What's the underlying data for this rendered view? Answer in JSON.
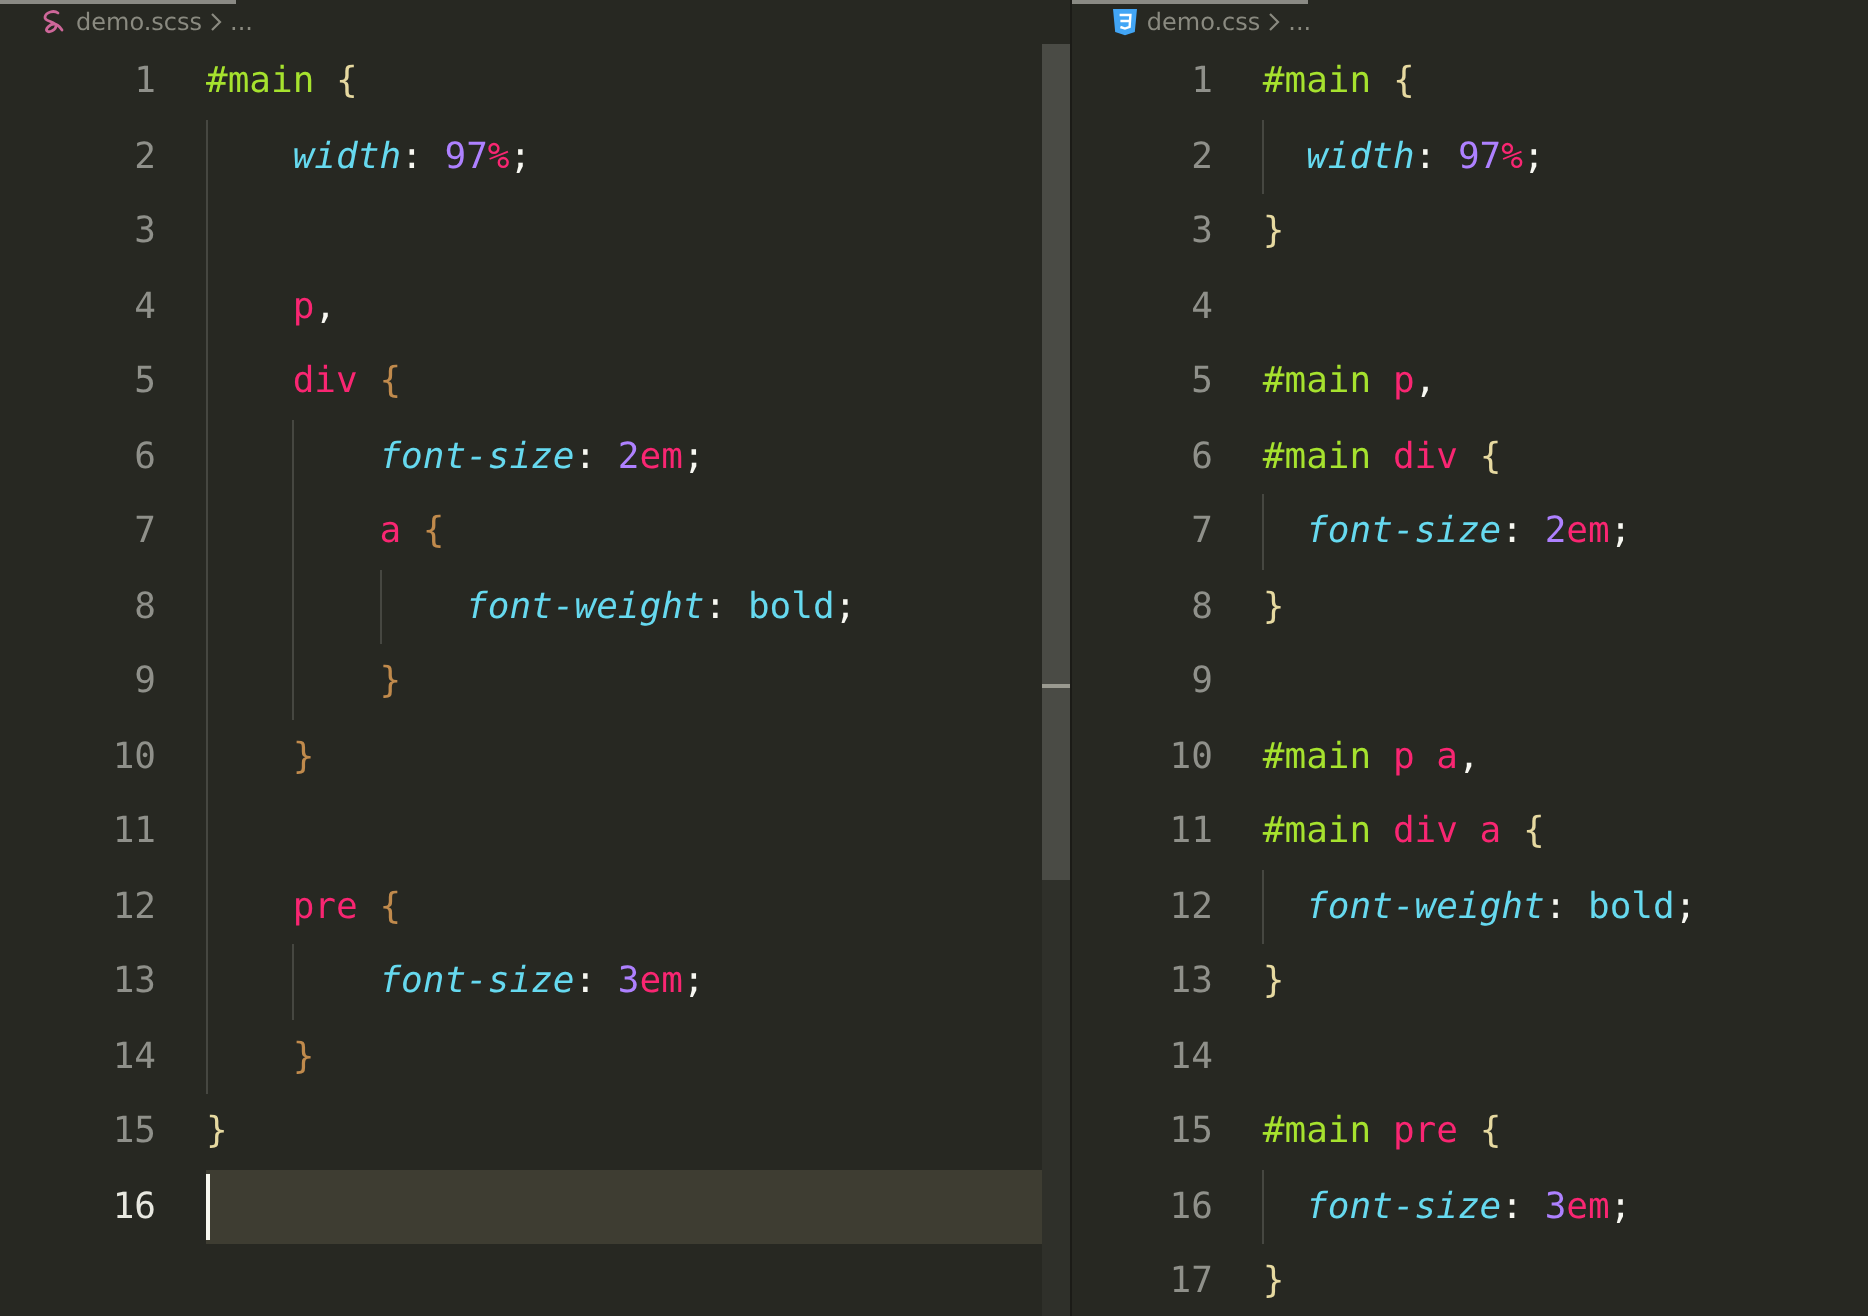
{
  "editors": [
    {
      "file_name": "demo.scss",
      "kind": "scss",
      "breadcrumb_tail": "...",
      "lines": [
        {
          "number": "1",
          "current": false,
          "tokens": [
            {
              "kind": "sel",
              "text": "#main "
            },
            {
              "kind": "brace1",
              "text": "{"
            }
          ]
        },
        {
          "number": "2",
          "current": false,
          "tokens": [
            {
              "kind": "prop",
              "text": "    width"
            },
            {
              "kind": "punct",
              "text": ": "
            },
            {
              "kind": "num",
              "text": "97"
            },
            {
              "kind": "unit",
              "text": "%"
            },
            {
              "kind": "punct",
              "text": ";"
            }
          ]
        },
        {
          "number": "3",
          "current": false
        },
        {
          "number": "4",
          "current": false,
          "tokens": [
            {
              "kind": "tag",
              "text": "    p"
            },
            {
              "kind": "punct",
              "text": ","
            }
          ]
        },
        {
          "number": "5",
          "current": false,
          "tokens": [
            {
              "kind": "tag",
              "text": "    div "
            },
            {
              "kind": "brace2",
              "text": "{"
            }
          ]
        },
        {
          "number": "6",
          "current": false,
          "tokens": [
            {
              "kind": "prop",
              "text": "        font-size"
            },
            {
              "kind": "punct",
              "text": ": "
            },
            {
              "kind": "num",
              "text": "2"
            },
            {
              "kind": "unit",
              "text": "em"
            },
            {
              "kind": "punct",
              "text": ";"
            }
          ]
        },
        {
          "number": "7",
          "current": false,
          "tokens": [
            {
              "kind": "tag",
              "text": "        a "
            },
            {
              "kind": "brace2",
              "text": "{"
            }
          ]
        },
        {
          "number": "8",
          "current": false,
          "tokens": [
            {
              "kind": "prop",
              "text": "            font-weight"
            },
            {
              "kind": "punct",
              "text": ": "
            },
            {
              "kind": "val",
              "text": "bold"
            },
            {
              "kind": "punct",
              "text": ";"
            }
          ]
        },
        {
          "number": "9",
          "current": false,
          "tokens": [
            {
              "kind": "brace2",
              "text": "        }"
            }
          ]
        },
        {
          "number": "10",
          "current": false,
          "tokens": [
            {
              "kind": "brace2",
              "text": "    }"
            }
          ]
        },
        {
          "number": "11",
          "current": false
        },
        {
          "number": "12",
          "current": false,
          "tokens": [
            {
              "kind": "tag",
              "text": "    pre "
            },
            {
              "kind": "brace2",
              "text": "{"
            }
          ]
        },
        {
          "number": "13",
          "current": false,
          "tokens": [
            {
              "kind": "prop",
              "text": "        font-size"
            },
            {
              "kind": "punct",
              "text": ": "
            },
            {
              "kind": "num",
              "text": "3"
            },
            {
              "kind": "unit",
              "text": "em"
            },
            {
              "kind": "punct",
              "text": ";"
            }
          ]
        },
        {
          "number": "14",
          "current": false,
          "tokens": [
            {
              "kind": "brace2",
              "text": "    }"
            }
          ]
        },
        {
          "number": "15",
          "current": false,
          "tokens": [
            {
              "kind": "brace1",
              "text": "}"
            }
          ]
        },
        {
          "number": "16",
          "current": true
        }
      ]
    },
    {
      "file_name": "demo.css",
      "kind": "css",
      "breadcrumb_tail": "...",
      "lines": [
        {
          "number": "1",
          "current": false,
          "tokens": [
            {
              "kind": "sel",
              "text": "#main "
            },
            {
              "kind": "brace1",
              "text": "{"
            }
          ]
        },
        {
          "number": "2",
          "current": false,
          "tokens": [
            {
              "kind": "prop",
              "text": "  width"
            },
            {
              "kind": "punct",
              "text": ": "
            },
            {
              "kind": "num",
              "text": "97"
            },
            {
              "kind": "unit",
              "text": "%"
            },
            {
              "kind": "punct",
              "text": ";"
            }
          ]
        },
        {
          "number": "3",
          "current": false,
          "tokens": [
            {
              "kind": "brace1",
              "text": "}"
            }
          ]
        },
        {
          "number": "4",
          "current": false
        },
        {
          "number": "5",
          "current": false,
          "tokens": [
            {
              "kind": "sel",
              "text": "#main "
            },
            {
              "kind": "tag",
              "text": "p"
            },
            {
              "kind": "punct",
              "text": ","
            }
          ]
        },
        {
          "number": "6",
          "current": false,
          "tokens": [
            {
              "kind": "sel",
              "text": "#main "
            },
            {
              "kind": "tag",
              "text": "div "
            },
            {
              "kind": "brace1",
              "text": "{"
            }
          ]
        },
        {
          "number": "7",
          "current": false,
          "tokens": [
            {
              "kind": "prop",
              "text": "  font-size"
            },
            {
              "kind": "punct",
              "text": ": "
            },
            {
              "kind": "num",
              "text": "2"
            },
            {
              "kind": "unit",
              "text": "em"
            },
            {
              "kind": "punct",
              "text": ";"
            }
          ]
        },
        {
          "number": "8",
          "current": false,
          "tokens": [
            {
              "kind": "brace1",
              "text": "}"
            }
          ]
        },
        {
          "number": "9",
          "current": false
        },
        {
          "number": "10",
          "current": false,
          "tokens": [
            {
              "kind": "sel",
              "text": "#main "
            },
            {
              "kind": "tag",
              "text": "p a"
            },
            {
              "kind": "punct",
              "text": ","
            }
          ]
        },
        {
          "number": "11",
          "current": false,
          "tokens": [
            {
              "kind": "sel",
              "text": "#main "
            },
            {
              "kind": "tag",
              "text": "div a "
            },
            {
              "kind": "brace1",
              "text": "{"
            }
          ]
        },
        {
          "number": "12",
          "current": false,
          "tokens": [
            {
              "kind": "prop",
              "text": "  font-weight"
            },
            {
              "kind": "punct",
              "text": ": "
            },
            {
              "kind": "val",
              "text": "bold"
            },
            {
              "kind": "punct",
              "text": ";"
            }
          ]
        },
        {
          "number": "13",
          "current": false,
          "tokens": [
            {
              "kind": "brace1",
              "text": "}"
            }
          ]
        },
        {
          "number": "14",
          "current": false
        },
        {
          "number": "15",
          "current": false,
          "tokens": [
            {
              "kind": "sel",
              "text": "#main "
            },
            {
              "kind": "tag",
              "text": "pre "
            },
            {
              "kind": "brace1",
              "text": "{"
            }
          ]
        },
        {
          "number": "16",
          "current": false,
          "tokens": [
            {
              "kind": "prop",
              "text": "  font-size"
            },
            {
              "kind": "punct",
              "text": ": "
            },
            {
              "kind": "num",
              "text": "3"
            },
            {
              "kind": "unit",
              "text": "em"
            },
            {
              "kind": "punct",
              "text": ";"
            }
          ]
        },
        {
          "number": "17",
          "current": false,
          "tokens": [
            {
              "kind": "brace1",
              "text": "}"
            }
          ]
        }
      ]
    }
  ]
}
